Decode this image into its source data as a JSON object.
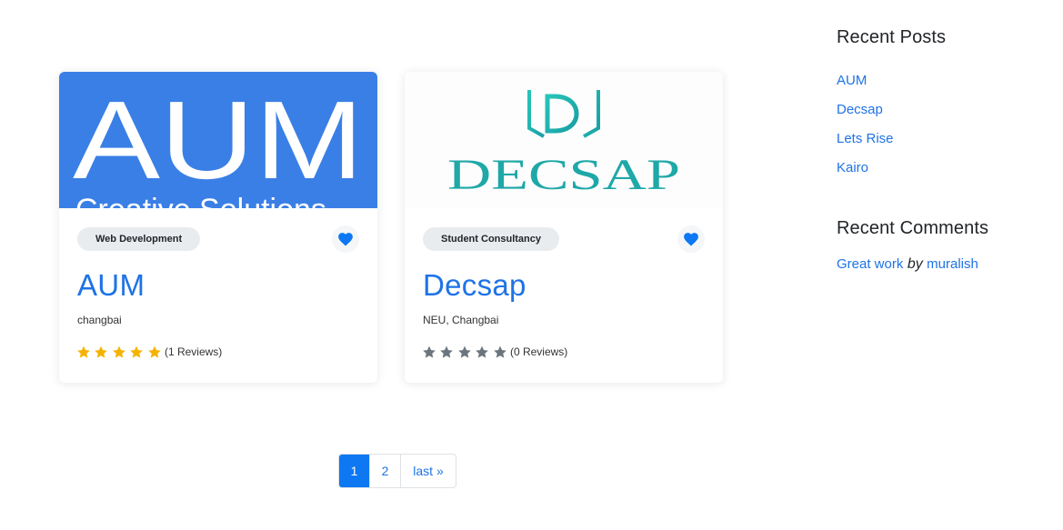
{
  "colors": {
    "accent": "#1e73e6",
    "aum_bg": "#3a7fe6",
    "star_filled": "#f5b301",
    "star_empty": "#6c757d",
    "heart": "#0d78f2",
    "badge_bg": "#e9ecef"
  },
  "listings": [
    {
      "image_logo": "AUM",
      "image_tagline": "Creative Solutions",
      "category": "Web Development",
      "title": "AUM",
      "location": "changbai",
      "rating": 5,
      "reviews": "(1 Reviews)",
      "icon": "heart-icon"
    },
    {
      "image_logo": "DECSAP",
      "category": "Student Consultancy",
      "title": "Decsap",
      "location": "NEU, Changbai",
      "rating": 0,
      "reviews": "(0 Reviews)",
      "icon": "heart-icon"
    }
  ],
  "pagination": {
    "pages": [
      "1",
      "2"
    ],
    "last": "last »",
    "current": "1"
  },
  "sidebar": {
    "recent_posts": {
      "title": "Recent Posts",
      "items": [
        "AUM",
        "Decsap",
        "Lets Rise",
        "Kairo"
      ]
    },
    "recent_comments": {
      "title": "Recent Comments",
      "comment_text": "Great work",
      "by": "by",
      "author": "muralish"
    }
  }
}
